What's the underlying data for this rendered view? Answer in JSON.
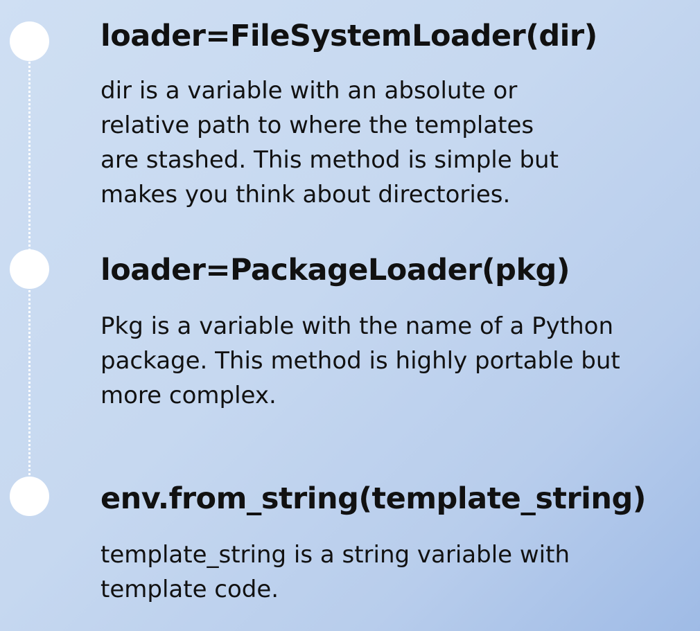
{
  "items": [
    {
      "title": "loader=FileSystemLoader(dir)",
      "description_lines": [
        "dir is a variable with an absolute or",
        "relative path to where the templates",
        "are stashed. This method is simple but",
        "makes you think about directories."
      ]
    },
    {
      "title": "loader=PackageLoader(pkg)",
      "description_lines": [
        "Pkg is a variable with the name of a Python",
        "package.  This method is highly portable but",
        "more complex."
      ]
    },
    {
      "title": "env.from_string(template_string)",
      "description_lines": [
        "template_string is a string variable with",
        "template code."
      ]
    }
  ],
  "colors": {
    "background_start": "#cfdff3",
    "background_end": "#9fbbe6",
    "dot": "#ffffff",
    "text": "#111111"
  }
}
